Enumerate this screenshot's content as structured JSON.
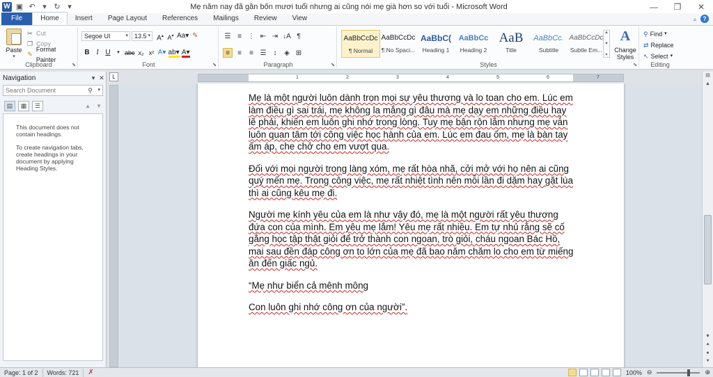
{
  "window": {
    "title": "Mẹ năm nay đã gần bốn mươi tuổi nhưng ai cũng nói mẹ già hơn so với tuổi  -  Microsoft Word"
  },
  "tabs": [
    {
      "label": "File"
    },
    {
      "label": "Home"
    },
    {
      "label": "Insert"
    },
    {
      "label": "Page Layout"
    },
    {
      "label": "References"
    },
    {
      "label": "Mailings"
    },
    {
      "label": "Review"
    },
    {
      "label": "View"
    }
  ],
  "ribbon": {
    "clipboard": {
      "label": "Clipboard",
      "paste": "Paste",
      "cut": "Cut",
      "copy": "Copy",
      "format_painter": "Format Painter"
    },
    "font": {
      "label": "Font",
      "family": "Segoe UI",
      "size": "13.5"
    },
    "paragraph": {
      "label": "Paragraph"
    },
    "styles": {
      "label": "Styles",
      "items": [
        {
          "sample": "AaBbCcDc",
          "name": "¶ Normal"
        },
        {
          "sample": "AaBbCcDc",
          "name": "¶ No Spaci..."
        },
        {
          "sample": "AaBbC(",
          "name": "Heading 1"
        },
        {
          "sample": "AaBbCc",
          "name": "Heading 2"
        },
        {
          "sample": "AaB",
          "name": "Title"
        },
        {
          "sample": "AaBbCc.",
          "name": "Subtitle"
        },
        {
          "sample": "AaBbCcDc",
          "name": "Subtle Em..."
        }
      ],
      "change_styles_line1": "Change",
      "change_styles_line2": "Styles"
    },
    "editing": {
      "label": "Editing",
      "find": "Find",
      "replace": "Replace",
      "select": "Select"
    }
  },
  "navigation": {
    "title": "Navigation",
    "search_placeholder": "Search Document",
    "message1": "This document does not contain headings.",
    "message2": "To create navigation tabs, create headings in your document by applying Heading Styles."
  },
  "ruler": {
    "numbers": [
      "1",
      "2",
      "3",
      "4",
      "5",
      "6",
      "7"
    ]
  },
  "document": {
    "paragraphs": [
      "Mẹ là một người luôn dành trọn mọi sự yêu thương và lo toan cho em. Lúc em làm điều gì sai trái, mẹ không la mắng gì đâu mà mẹ dạy em những điều hay lẽ phải, khiến em luôn ghi nhớ trong lòng. Tuy mẹ bận rộn lắm nhưng mẹ vẫn luôn quan tâm tới công việc học hành của em. Lúc em đau ốm, mẹ là bàn tay ấm áp, che chở cho em vượt qua.",
      "Đối với mọi người trong làng xóm, mẹ rất hòa nhã, cởi mở với họ nên ai cũng quý mến mẹ. Trong công việc, mẹ rất nhiệt tình nên mỗi lần đi dặm hay gặt lúa thì ai cũng kêu mẹ đi.",
      "Người mẹ kính yêu của em là như vậy đó, mẹ là một người rất yêu thương đứa con của mình. Em yêu mẹ lắm! Yêu mẹ rất nhiều. Em tự nhủ rằng sẽ cố gắng học tập thật giỏi để trở thành con ngoan, trò giỏi, cháu ngoan Bác Hồ, mai sau đền đáp công ơn to lớn của mẹ đã bao năm chăm lo cho em từ miếng ăn đến giấc ngủ.",
      "“Mẹ như biển cả mênh mông",
      "Con luôn ghi nhớ công ơn của người”."
    ]
  },
  "status": {
    "page": "Page: 1 of 2",
    "words": "Words: 721",
    "zoom": "100%"
  },
  "colors": {
    "file_tab": "#2b5fad",
    "selected": "#f6dc91",
    "spell_underline": "#d02020"
  }
}
